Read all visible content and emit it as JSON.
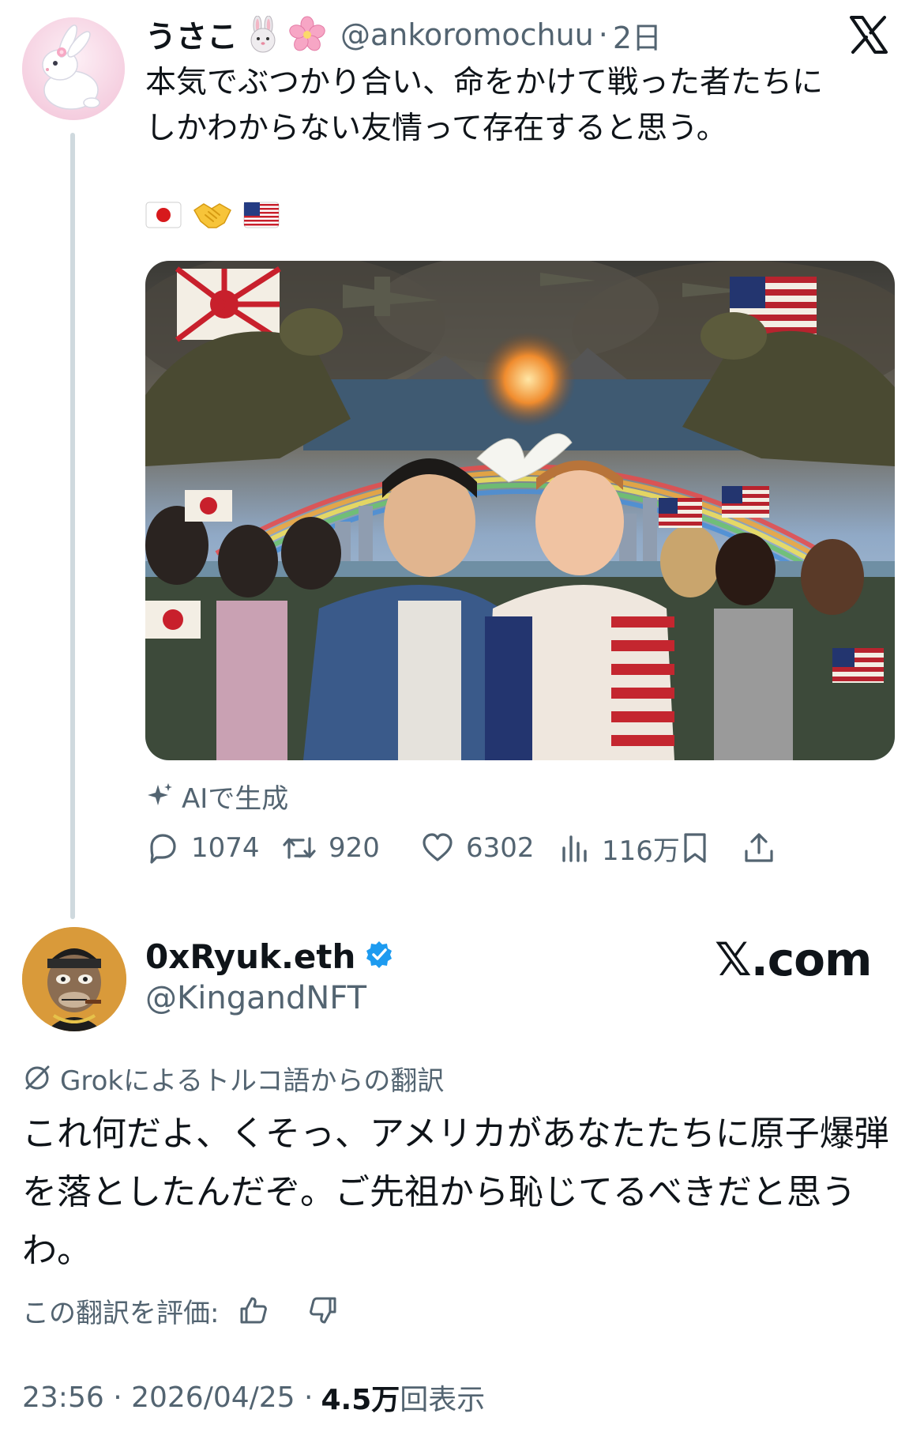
{
  "tweet1": {
    "display_name": "うさこ",
    "name_emojis": [
      "rabbit-face-icon",
      "cherry-blossom-icon"
    ],
    "handle": "@ankoromochuu",
    "separator": "·",
    "time": "2日",
    "text_line1": "本気でぶつかり合い、命をかけて戦った者たちに",
    "text_line2": "しかわからない友情って存在すると思う。",
    "emoji_row": [
      "japan-flag-icon",
      "handshake-icon",
      "usa-flag-icon"
    ],
    "ai_label": "AIで生成",
    "stats": {
      "replies": "1074",
      "reposts": "920",
      "likes": "6302",
      "views": "116万"
    }
  },
  "tweet2": {
    "display_name": "0xRyuk.eth",
    "handle": "@KingandNFT",
    "verified": true,
    "watermark": "𝕏.com",
    "translation_label": "Grokによるトルコ語からの翻訳",
    "text": "これ何だよ、くそっ、アメリカがあなたたちに原子爆弾を落としたんだぞ。ご先祖から恥じてるべきだと思うわ。",
    "rate_label": "この翻訳を評価:",
    "timestamp": "23:56 · 2026/04/25 ·",
    "views_count": "4.5万",
    "views_suffix": "回表示"
  },
  "colors": {
    "text": "#0f1419",
    "muted": "#536471",
    "verified": "#1d9bf0",
    "thread_line": "#cfd9de"
  }
}
